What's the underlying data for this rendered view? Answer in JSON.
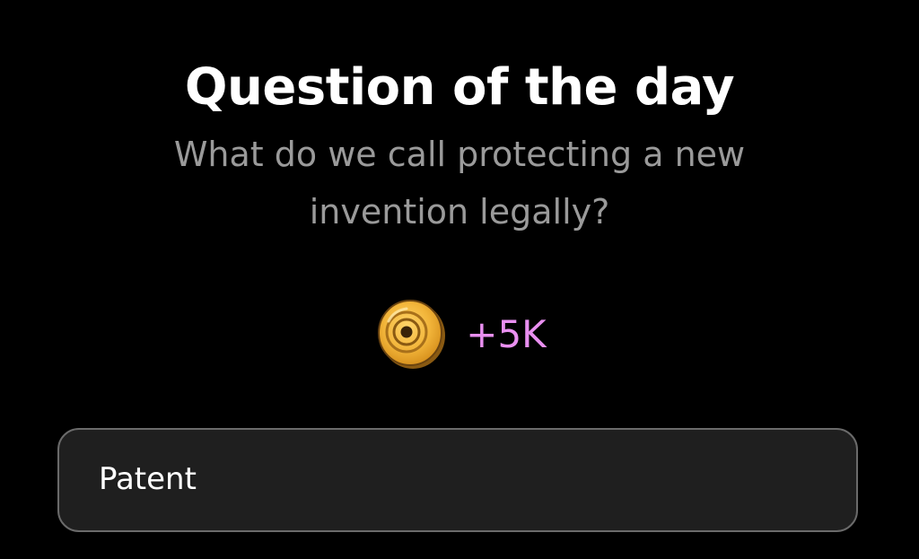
{
  "header": {
    "title": "Question of the day",
    "question": "What do we call protecting a new invention legally?"
  },
  "reward": {
    "icon": "coin-icon",
    "amount": "+5K",
    "color": "#e98ff0"
  },
  "answers": [
    {
      "label": "Patent"
    }
  ]
}
